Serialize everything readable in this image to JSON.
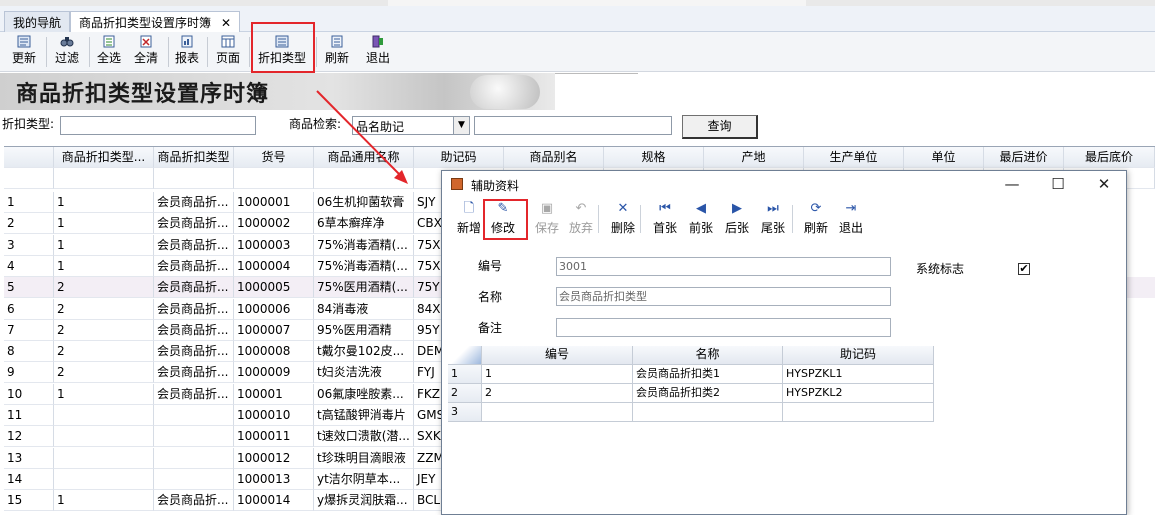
{
  "tabs": [
    {
      "label": "我的导航"
    },
    {
      "label": "商品折扣类型设置序时簿",
      "close": "✕"
    }
  ],
  "toolbar": {
    "buttons": [
      {
        "label": "更新",
        "icon": "update-icon"
      },
      {
        "label": "过滤",
        "icon": "filter-icon"
      },
      {
        "label": "全选",
        "icon": "select-all-icon"
      },
      {
        "label": "全清",
        "icon": "clear-all-icon"
      },
      {
        "label": "报表",
        "icon": "report-icon"
      },
      {
        "label": "页面",
        "icon": "page-icon"
      },
      {
        "label": "折扣类型",
        "icon": "discount-type-icon"
      },
      {
        "label": "刷新",
        "icon": "refresh-icon"
      },
      {
        "label": "退出",
        "icon": "exit-icon"
      }
    ]
  },
  "banner": {
    "title": "商品折扣类型设置序时簿"
  },
  "filter": {
    "discount_type_label": "折扣类型:",
    "discount_type_value": "",
    "search_label": "商品检索:",
    "search_mode": "品名助记",
    "search_value": "",
    "query_button": "查询"
  },
  "grid": {
    "headers": [
      "",
      "商品折扣类型...",
      "商品折扣类型",
      "货号",
      "商品通用名称",
      "助记码",
      "商品别名",
      "规格",
      "产地",
      "生产单位",
      "单位",
      "最后进价",
      "最后底价"
    ],
    "rows": [
      [
        "1",
        "1",
        "会员商品折...",
        "1000001",
        "06生机抑菌软膏",
        "SJY"
      ],
      [
        "2",
        "1",
        "会员商品折...",
        "1000002",
        "6草本癣痒净",
        "CBX"
      ],
      [
        "3",
        "1",
        "会员商品折...",
        "1000003",
        "75%消毒酒精(...",
        "75X"
      ],
      [
        "4",
        "1",
        "会员商品折...",
        "1000004",
        "75%消毒酒精(...",
        "75X"
      ],
      [
        "5",
        "2",
        "会员商品折...",
        "1000005",
        "75%医用酒精(...",
        "75Y"
      ],
      [
        "6",
        "2",
        "会员商品折...",
        "1000006",
        "84消毒液",
        "84X"
      ],
      [
        "7",
        "2",
        "会员商品折...",
        "1000007",
        "95%医用酒精",
        "95Y"
      ],
      [
        "8",
        "2",
        "会员商品折...",
        "1000008",
        "t戴尔曼102皮...",
        "DEM"
      ],
      [
        "9",
        "2",
        "会员商品折...",
        "1000009",
        "t妇炎洁洗液",
        "FYJ"
      ],
      [
        "10",
        "1",
        "会员商品折...",
        "100001",
        "06氟康唑胺素...",
        "FKZ"
      ],
      [
        "11",
        "",
        "",
        "1000010",
        "t高锰酸钾消毒片",
        "GMS"
      ],
      [
        "12",
        "",
        "",
        "1000011",
        "t速效口溃散(潜...",
        "SXK"
      ],
      [
        "13",
        "",
        "",
        "1000012",
        "t珍珠明目滴眼液",
        "ZZM"
      ],
      [
        "14",
        "",
        "",
        "1000013",
        "yt洁尔阴草本...",
        "JEY"
      ],
      [
        "15",
        "1",
        "会员商品折...",
        "1000014",
        "y爆拆灵润肤霜...",
        "BCL"
      ]
    ]
  },
  "dialog": {
    "title": "辅助资料",
    "window_controls": {
      "minimize": "—",
      "maximize": "☐",
      "close": "✕"
    },
    "toolbar": [
      {
        "label": "新增",
        "icon": "new-icon",
        "glyph": "🗋",
        "enabled": true
      },
      {
        "label": "修改",
        "icon": "edit-icon",
        "glyph": "✎",
        "enabled": true
      },
      {
        "label": "保存",
        "icon": "save-icon",
        "glyph": "▣",
        "enabled": false
      },
      {
        "label": "放弃",
        "icon": "undo-icon",
        "glyph": "↶",
        "enabled": false
      },
      {
        "label": "删除",
        "icon": "delete-icon",
        "glyph": "✕",
        "enabled": true
      },
      {
        "label": "首张",
        "icon": "first-icon",
        "glyph": "⏮",
        "enabled": true
      },
      {
        "label": "前张",
        "icon": "prev-icon",
        "glyph": "◀",
        "enabled": true
      },
      {
        "label": "后张",
        "icon": "next-icon",
        "glyph": "▶",
        "enabled": true
      },
      {
        "label": "尾张",
        "icon": "last-icon",
        "glyph": "⏭",
        "enabled": true
      },
      {
        "label": "刷新",
        "icon": "refresh-icon",
        "glyph": "⟳",
        "enabled": true
      },
      {
        "label": "退出",
        "icon": "exit-icon",
        "glyph": "⇥",
        "enabled": true
      }
    ],
    "fields": {
      "code_label": "编号",
      "code_value": "3001",
      "name_label": "名称",
      "name_value": "会员商品折扣类型",
      "remark_label": "备注",
      "remark_value": "",
      "system_flag_label": "系统标志",
      "system_flag_checked": "✔"
    },
    "subgrid": {
      "headers": [
        "编号",
        "名称",
        "助记码"
      ],
      "rows": [
        [
          "1",
          "1",
          "会员商品折扣类1",
          "HYSPZKL1"
        ],
        [
          "2",
          "2",
          "会员商品折扣类2",
          "HYSPZKL2"
        ],
        [
          "3",
          "",
          "",
          ""
        ]
      ]
    }
  },
  "colors": {
    "highlight_box": "#e3262b",
    "selected_row": "#f3eef5"
  }
}
